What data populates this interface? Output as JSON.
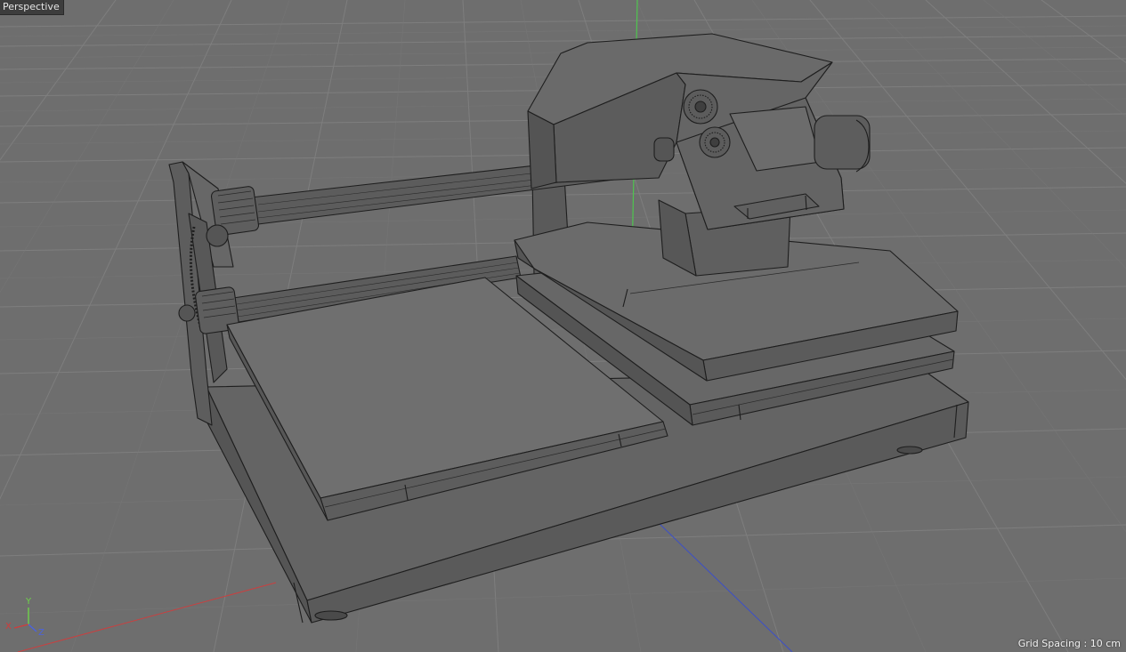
{
  "viewport": {
    "view_name": "Perspective",
    "grid_spacing_label": "Grid Spacing : 10 cm"
  },
  "axis_gizmo": {
    "x_label": "X",
    "y_label": "Y",
    "z_label": "Z",
    "x_color": "#d23b3b",
    "y_color": "#6fd24a",
    "z_color": "#4b63e0"
  },
  "scene_colors": {
    "background": "#6e6e6e",
    "grid_line": "#828282",
    "grid_major": "#8e8e8e",
    "model_light": "#6f6f6f",
    "model_mid": "#626262",
    "model_dark": "#545454",
    "wire": "#1e1e1e"
  },
  "model": {
    "name_icon": "heat-press-model"
  }
}
